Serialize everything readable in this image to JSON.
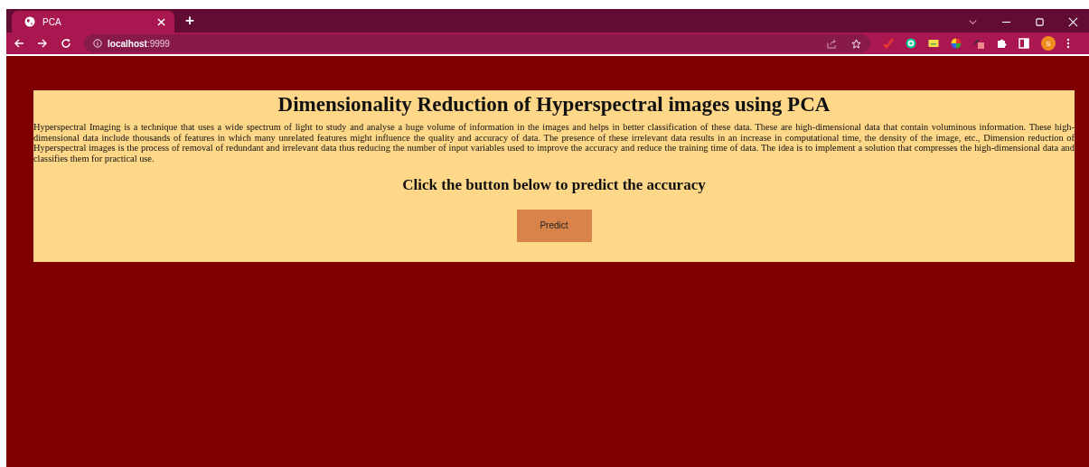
{
  "browser": {
    "tabs": [
      {
        "label": "PCA",
        "selected": true
      }
    ],
    "new_tab": "+",
    "url": "**localhost**:9999",
    "profile_initial": "S"
  },
  "page": {
    "title": "Dimensionality Reduction of Hyperspectral images using PCA",
    "description": "Hyperspectral Imaging is a technique that uses a wide spectrum of light to study and analyse a huge volume of information in the images and helps in better classification of these data. These are high-dimensional data that contain voluminous information. These high-dimensional data include thousands of features in which many unrelated features might influence the quality and accuracy of data. The presence of these irrelevant data results in an increase in computational time, the density of the image, etc., Dimension reduction of Hyperspectral images is the process of removal of redundant and irrelevant data thus reducing the number of input variables used to improve the accuracy and reduce the training time of data. The idea is to implement a solution that compresses the high-dimensional data and classifies them for practical use.",
    "prompt": "Click the button below to predict the accuracy",
    "button": "Predict"
  }
}
